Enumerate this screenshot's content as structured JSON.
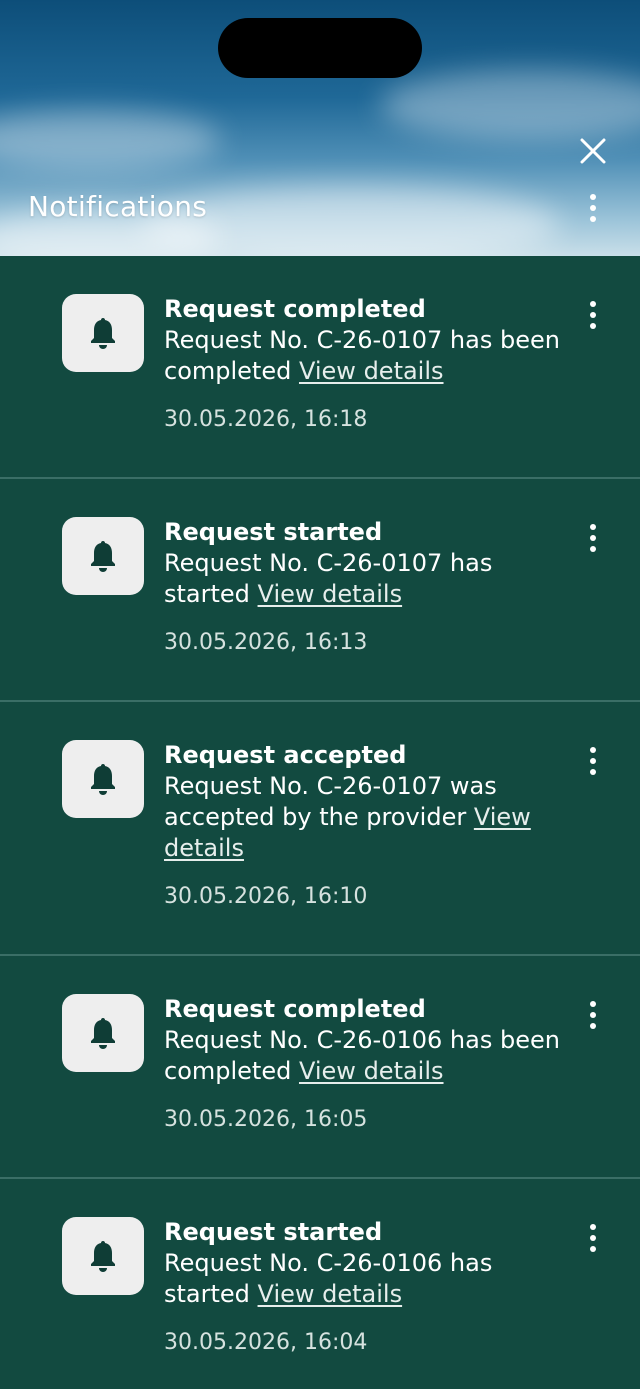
{
  "header": {
    "title": "Notifications"
  },
  "notifications": [
    {
      "title": "Request completed",
      "body_prefix": "Request No. C-26-0107 has been completed",
      "link": "View details",
      "time": "30.05.2026, 16:18"
    },
    {
      "title": "Request started",
      "body_prefix": "Request No. C-26-0107 has started",
      "link": "View details",
      "time": "30.05.2026, 16:13"
    },
    {
      "title": "Request accepted",
      "body_prefix": "Request No. C-26-0107 was accepted by the provider",
      "link": "View details",
      "time": "30.05.2026, 16:10"
    },
    {
      "title": "Request completed",
      "body_prefix": "Request No. C-26-0106 has been completed",
      "link": "View details",
      "time": "30.05.2026, 16:05"
    },
    {
      "title": "Request started",
      "body_prefix": "Request No. C-26-0106 has started",
      "link": "View details",
      "time": "30.05.2026, 16:04"
    }
  ],
  "icons": {
    "close": "close-icon",
    "more": "more-vertical-icon",
    "bell": "bell-icon"
  },
  "colors": {
    "background": "#124a40",
    "divider": "#3a6e66",
    "icon_tile": "#eeeeee",
    "bell": "#0f3d36"
  }
}
